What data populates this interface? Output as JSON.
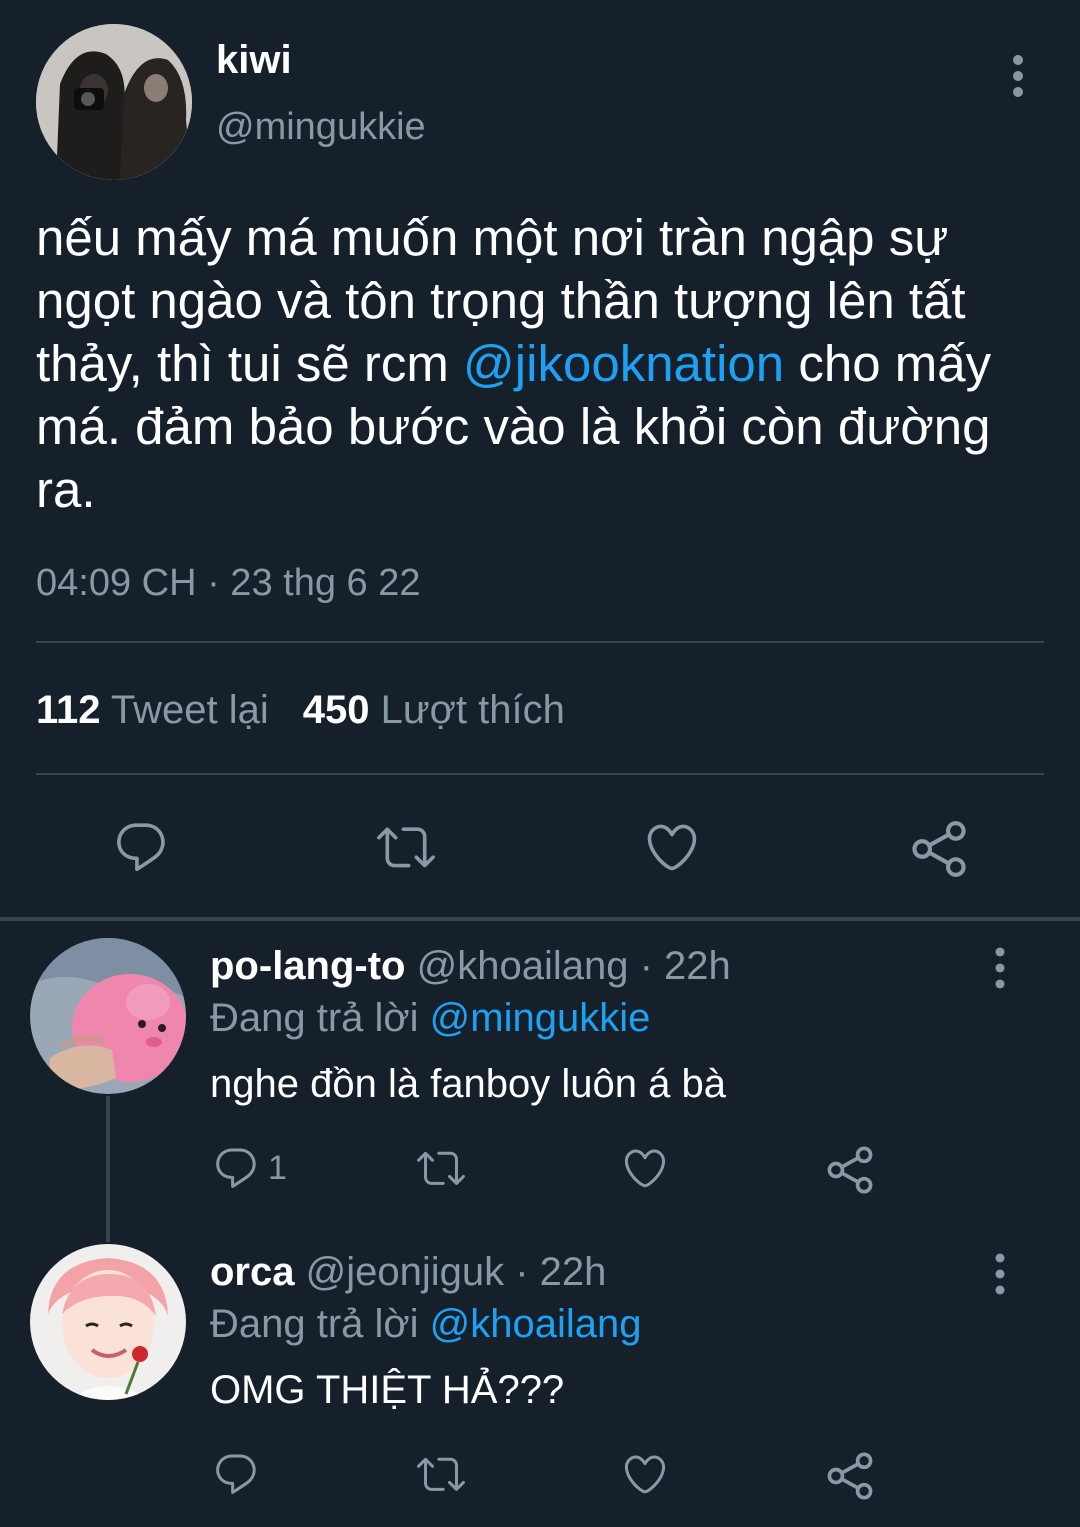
{
  "tweet": {
    "name": "kiwi",
    "handle": "@mingukkie",
    "text_before": "nếu mấy má muốn một nơi tràn ngập sự ngọt ngào và tôn trọng thần tượng lên tất thảy, thì tui sẽ rcm ",
    "mention": "@jikooknation",
    "text_after": " cho mấy má. đảm bảo bước vào là khỏi còn đường ra.",
    "timestamp": "04:09 CH · 23 thg 6 22",
    "retweet_count": "112",
    "retweet_label": "Tweet lại",
    "like_count": "450",
    "like_label": "Lượt thích"
  },
  "replies": [
    {
      "name": "po-lang-to",
      "handle_time": "@khoailang · 22h",
      "replying_label": "Đang trả lời",
      "replying_to": "@mingukkie",
      "text": "nghe đồn là fanboy luôn á bà",
      "reply_count": "1"
    },
    {
      "name": "orca",
      "handle_time": "@jeonjiguk · 22h",
      "replying_label": "Đang trả lời",
      "replying_to": "@khoailang",
      "text": "OMG THIỆT HẢ???",
      "reply_count": ""
    }
  ],
  "icons": {
    "reply": "comment-bubble-icon",
    "retweet": "retweet-arrows-icon",
    "like": "heart-icon",
    "share": "share-nodes-icon",
    "more": "vertical-dots-icon"
  },
  "colors": {
    "background": "#15202b",
    "text": "#ffffff",
    "secondary": "#8899a6",
    "accent": "#1da1f2",
    "divider": "#38444d"
  }
}
